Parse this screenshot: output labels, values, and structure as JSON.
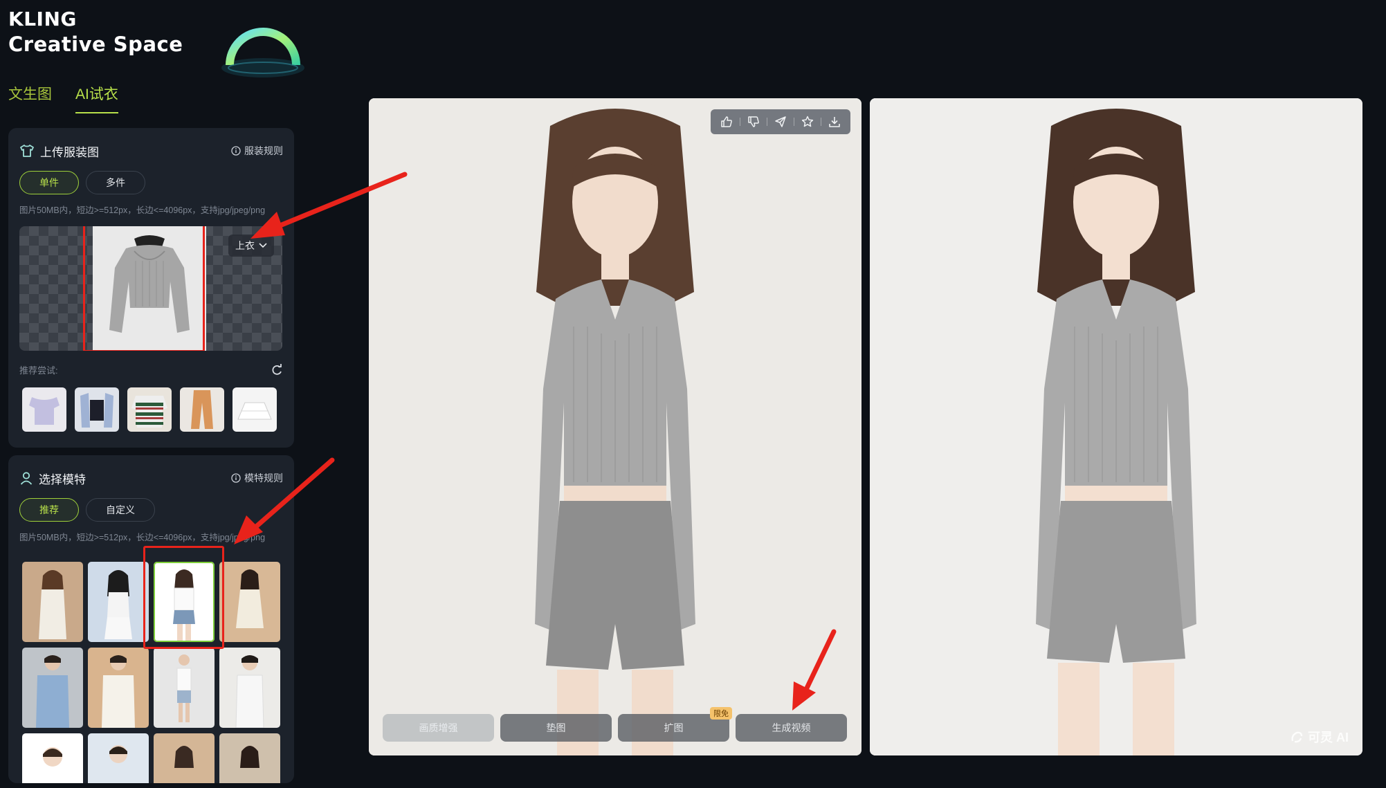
{
  "brand": {
    "line1": "KLING",
    "line2": "Creative Space"
  },
  "tabs": [
    {
      "label": "文生图",
      "active": false
    },
    {
      "label": "AI试衣",
      "active": true
    }
  ],
  "upload_panel": {
    "title": "上传服装图",
    "rule_link": "服装规则",
    "modes": [
      "单件",
      "多件"
    ],
    "active_mode": "单件",
    "hint": "图片50MB内，短边>=512px，长边<=4096px，支持jpg/jpeg/png",
    "category": "上衣",
    "recommend_label": "推荐尝试:",
    "recommend_items": [
      "purple-ruffle-top",
      "denim-vest-top",
      "striped-polo",
      "orange-pants",
      "white-skirt"
    ]
  },
  "model_panel": {
    "title": "选择模特",
    "rule_link": "模特规则",
    "modes": [
      "推荐",
      "自定义"
    ],
    "active_mode": "推荐",
    "hint": "图片50MB内，短边>=512px，长边<=4096px，支持jpg/jpeg/png"
  },
  "result_actions": {
    "buttons": [
      "画质增强",
      "垫图",
      "扩图",
      "生成视频"
    ],
    "badge": "限免"
  },
  "watermark": "可灵 AI",
  "colors": {
    "accent": "#b7e04a",
    "highlight": "#e8231b",
    "background": "#0d1117",
    "panel": "#1c222b"
  }
}
